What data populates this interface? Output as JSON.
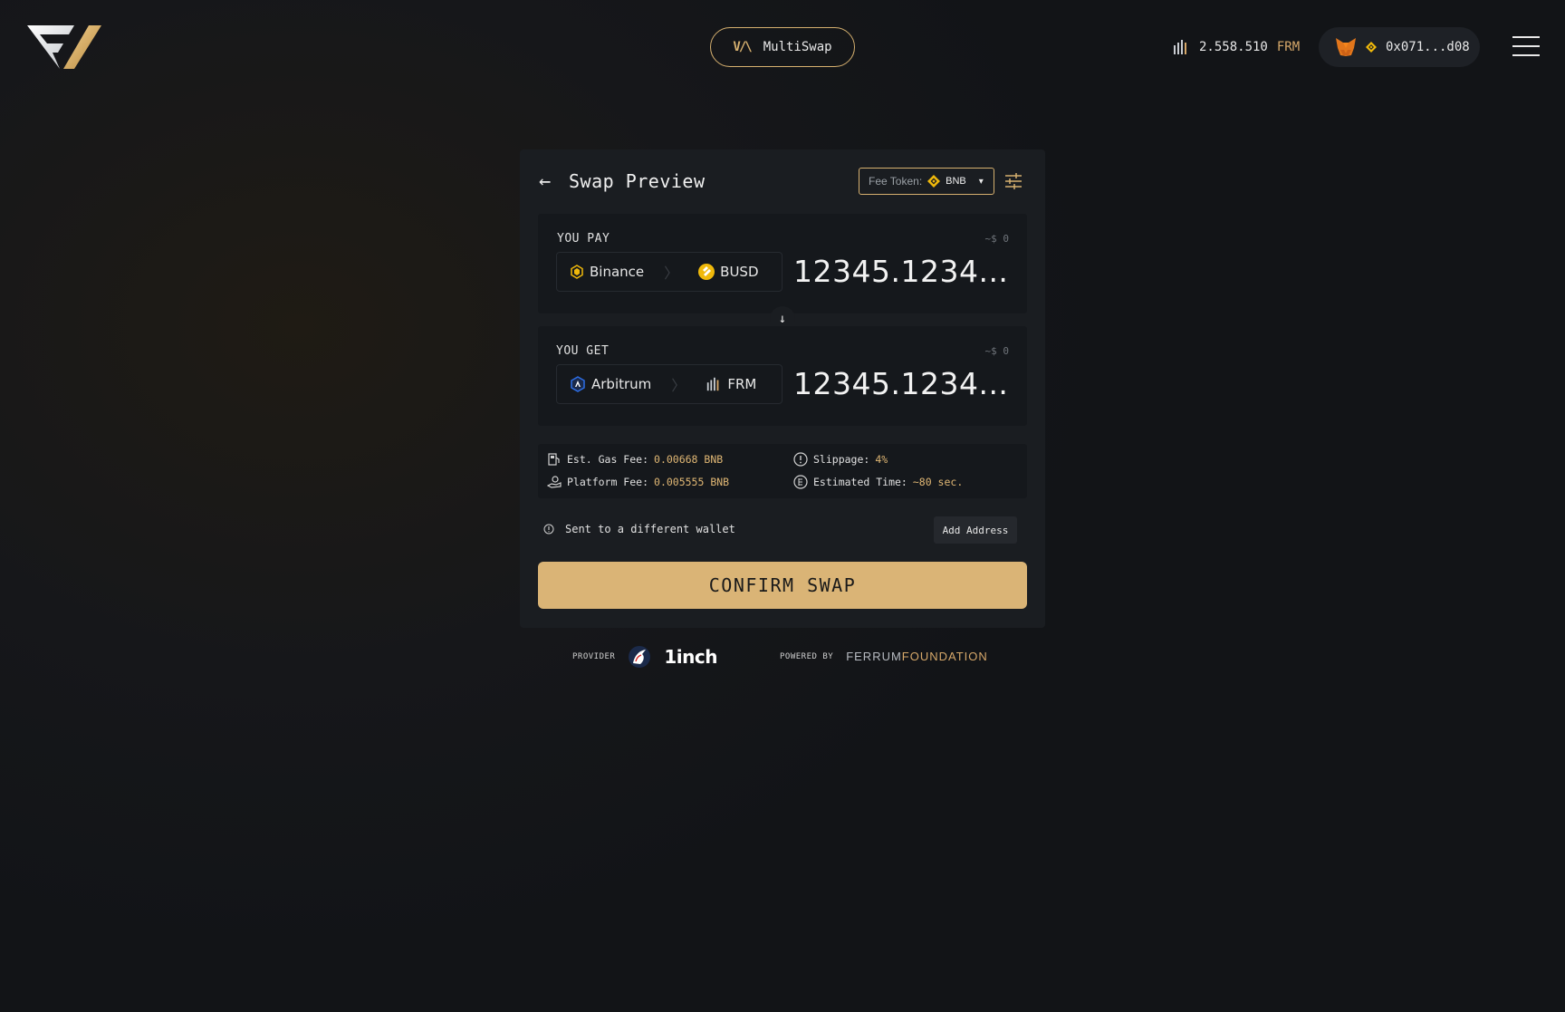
{
  "header": {
    "multiswap_label": "MultiSwap",
    "balance_amount": "2.558.510",
    "balance_token": "FRM",
    "wallet_address": "0x071...d08"
  },
  "card": {
    "title": "Swap Preview",
    "fee_token_label": "Fee Token:",
    "fee_token_value": "BNB",
    "pay": {
      "label": "YOU PAY",
      "usd": "~$ 0",
      "network": "Binance",
      "token": "BUSD",
      "amount": "12345.1234..."
    },
    "get": {
      "label": "YOU GET",
      "usd": "~$ 0",
      "network": "Arbitrum",
      "token": "FRM",
      "amount": "12345.1234..."
    },
    "fees": {
      "gas_label": "Est. Gas Fee:",
      "gas_value": "0.00668 BNB",
      "platform_label": "Platform Fee:",
      "platform_value": "0.005555 BNB",
      "slippage_label": "Slippage:",
      "slippage_value": "4%",
      "time_label": "Estimated Time:",
      "time_value": "~80 sec."
    },
    "different_wallet": "Sent to a different wallet",
    "add_address": "Add Address",
    "confirm": "CONFIRM SWAP"
  },
  "footer": {
    "provider_label": "PROVIDER",
    "provider_name": "1inch",
    "powered_label": "POWERED BY",
    "powered_name_a": "FERRUM",
    "powered_name_b": "FOUNDATION"
  },
  "colors": {
    "accent_gold": "#dab476",
    "background": "#16171a",
    "card": "#1a1d21"
  }
}
